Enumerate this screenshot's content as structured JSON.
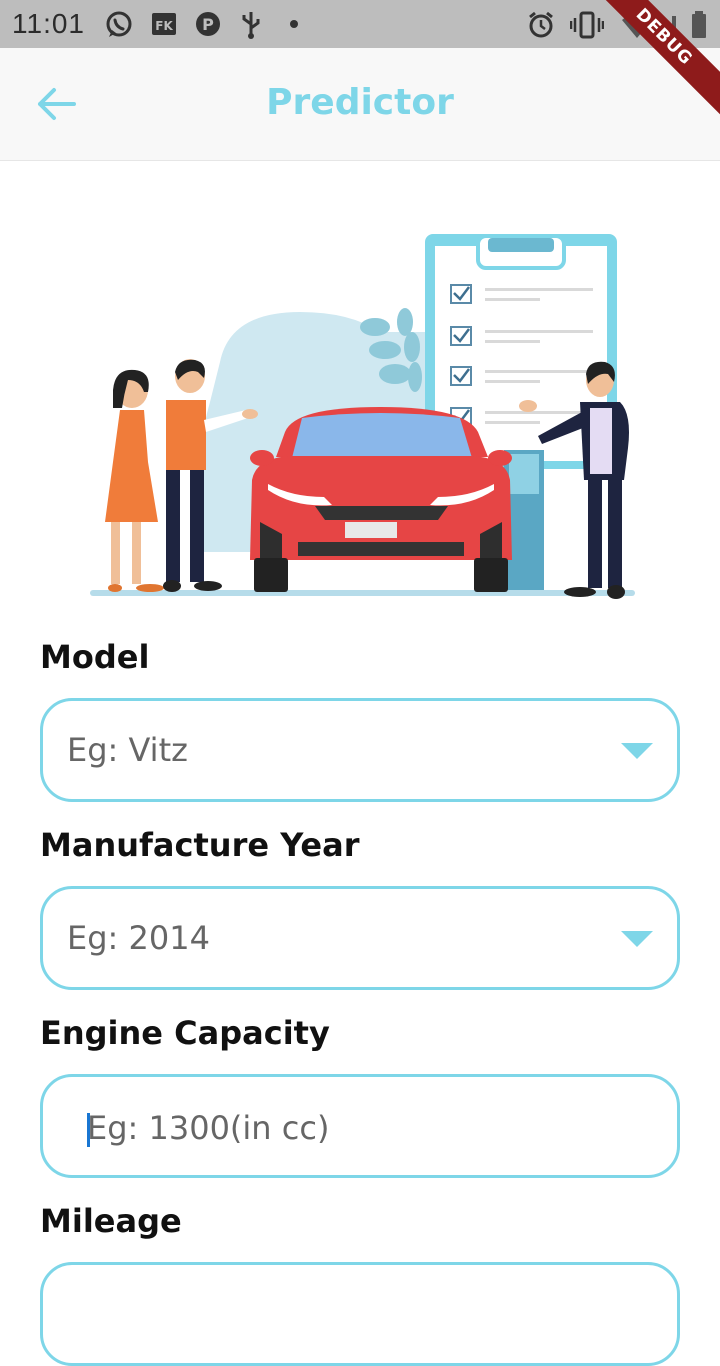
{
  "status_bar": {
    "time": "11:01",
    "left_icons": [
      "whatsapp-icon",
      "fk-icon",
      "p-icon",
      "usb-icon",
      "dot-icon"
    ],
    "right_icons": [
      "alarm-icon",
      "vibrate-icon",
      "wifi-icon",
      "signal-icon",
      "battery-icon"
    ]
  },
  "debug_banner": "DEBUG",
  "app_bar": {
    "title": "Predictor",
    "back_icon": "arrow-left-icon"
  },
  "colors": {
    "accent": "#7ed6e8",
    "car_red": "#e64545",
    "debug_red": "#8e1b1b"
  },
  "form": {
    "model": {
      "label": "Model",
      "placeholder": "Eg: Vitz"
    },
    "manufacture_year": {
      "label": "Manufacture Year",
      "placeholder": "Eg: 2014"
    },
    "engine_capacity": {
      "label": "Engine Capacity",
      "placeholder": "Eg: 1300(in cc)"
    },
    "mileage": {
      "label": "Mileage"
    }
  }
}
